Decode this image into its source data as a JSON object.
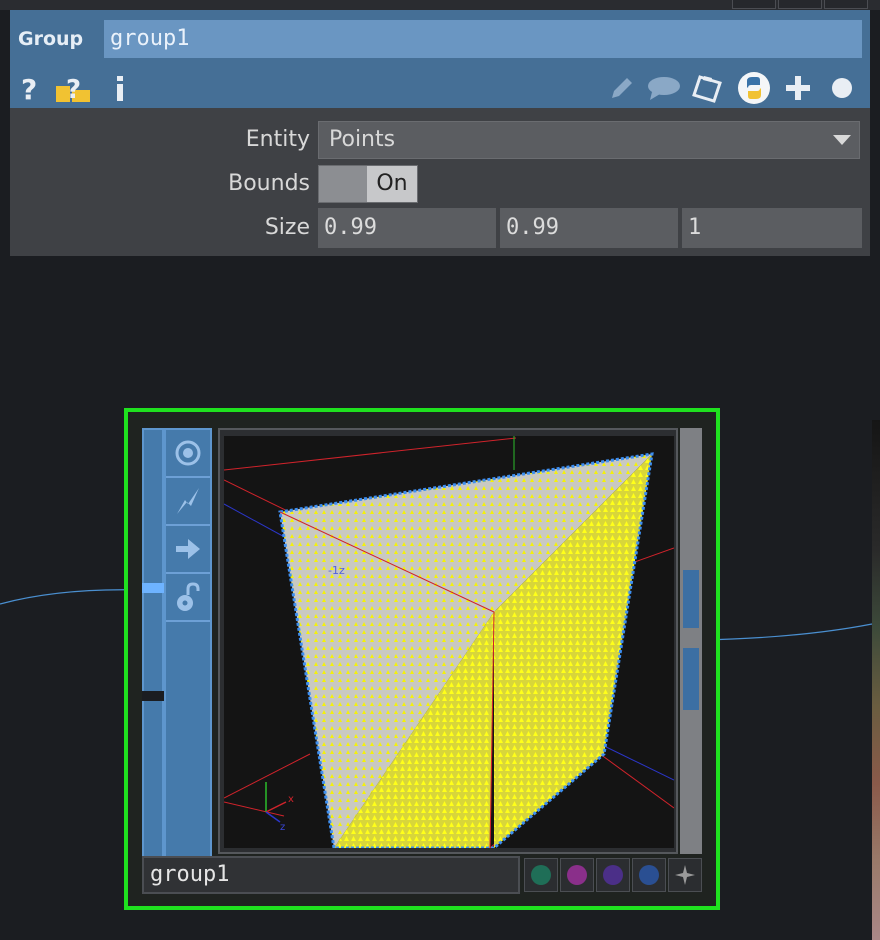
{
  "params": {
    "op_type": "Group",
    "op_name": "group1",
    "rows": {
      "entity": {
        "label": "Entity",
        "value": "Points"
      },
      "bounds": {
        "label": "Bounds",
        "value": "On"
      },
      "size": {
        "label": "Size",
        "values": [
          "0.99",
          "0.99",
          "1"
        ]
      }
    },
    "icons": [
      "help-icon",
      "python-help-icon",
      "info-icon",
      "pencil-icon",
      "comment-icon",
      "clipboard-icon",
      "python-icon",
      "plus-icon",
      "circle-icon"
    ]
  },
  "node": {
    "name": "group1",
    "viewer_label": "-1z",
    "axis_x": "x",
    "axis_z": "z",
    "flags": [
      "viewer-icon",
      "bypass-icon",
      "display-icon",
      "lock-icon"
    ],
    "output_dots": [
      {
        "color": "#1f6e57"
      },
      {
        "color": "#8a2f8a"
      },
      {
        "color": "#4b2f88"
      },
      {
        "color": "#2a4f92"
      }
    ]
  }
}
